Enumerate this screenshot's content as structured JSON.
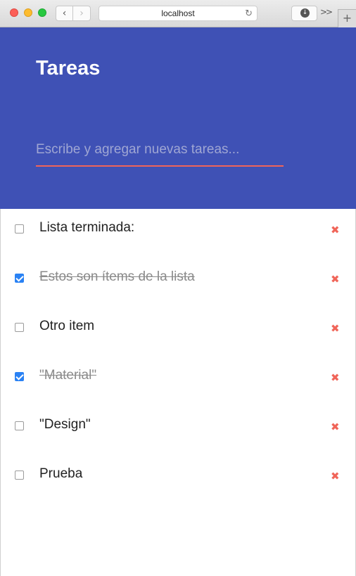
{
  "browser": {
    "address": "localhost",
    "icons": {
      "back": "chevron-left-icon",
      "forward": "chevron-right-icon",
      "reload": "reload-icon",
      "download": "download-icon",
      "more": "double-chevron-right-icon",
      "new_tab": "plus-icon"
    }
  },
  "app": {
    "title": "Tareas",
    "input_placeholder": "Escribe y agregar nuevas tareas...",
    "input_value": "",
    "colors": {
      "header_bg": "#3f51b5",
      "accent": "#f06559",
      "checkbox_checked": "#2a82f4"
    }
  },
  "tasks": [
    {
      "text": "Lista terminada:",
      "done": false
    },
    {
      "text": "Estos son ítems de la lista",
      "done": true
    },
    {
      "text": "Otro item",
      "done": false
    },
    {
      "text": "\"Material\"",
      "done": true
    },
    {
      "text": "\"Design\"",
      "done": false
    },
    {
      "text": "Prueba",
      "done": false
    }
  ]
}
